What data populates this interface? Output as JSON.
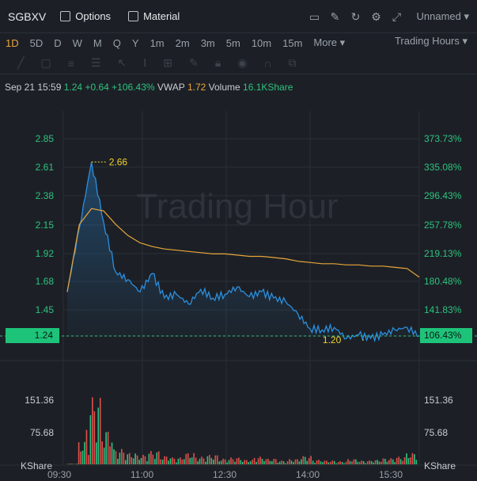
{
  "toolbar": {
    "ticker": "SGBXV",
    "options_label": "Options",
    "material_label": "Material",
    "layout_name": "Unnamed",
    "icons": [
      "chart-icon",
      "pen-icon",
      "refresh-icon",
      "gear-icon",
      "fullscreen-icon"
    ]
  },
  "periods": {
    "items": [
      "1D",
      "5D",
      "D",
      "W",
      "M",
      "Q",
      "Y",
      "1m",
      "2m",
      "3m",
      "5m",
      "10m",
      "15m",
      "More"
    ],
    "active": "1D",
    "session_label": "Trading Hours"
  },
  "info": {
    "datetime": "Sep 21 15:59",
    "last": "1.24",
    "change": "+0.64",
    "change_pct": "+106.43%",
    "vwap_label": "VWAP",
    "vwap": "1.72",
    "volume_label": "Volume",
    "volume": "16.1KShare"
  },
  "watermark": "Trading Hour",
  "price_axis": [
    "2.85",
    "2.61",
    "2.38",
    "2.15",
    "1.92",
    "1.68",
    "1.45"
  ],
  "pct_axis": [
    "373.73%",
    "335.08%",
    "296.43%",
    "257.78%",
    "219.13%",
    "180.48%",
    "141.83%"
  ],
  "current_price": "1.24",
  "current_pct": "106.43%",
  "high_label": "2.66",
  "low_label": "1.20",
  "volume_axis": [
    "151.36",
    "75.68"
  ],
  "volume_unit": "KShare",
  "time_axis": [
    "09:30",
    "11:00",
    "12:30",
    "14:00",
    "15:30"
  ],
  "colors": {
    "price_line": "#2b8fe0",
    "vwap_line": "#e9a53a",
    "up": "#2ec27e",
    "down": "#e0504a",
    "badge": "#1ec37a"
  },
  "chart_data": {
    "type": "line",
    "x": [
      "09:30",
      "09:35",
      "09:40",
      "09:45",
      "09:50",
      "10:00",
      "10:15",
      "10:30",
      "10:45",
      "11:00",
      "11:15",
      "11:30",
      "11:45",
      "12:00",
      "12:15",
      "12:30",
      "12:45",
      "13:00",
      "13:15",
      "13:30",
      "13:45",
      "14:00",
      "14:15",
      "14:30",
      "14:45",
      "15:00",
      "15:15",
      "15:30",
      "15:45",
      "15:59"
    ],
    "series": [
      {
        "values": [
          1.6,
          2.12,
          2.66,
          2.17,
          1.76,
          1.7,
          1.6,
          1.75,
          1.55,
          1.58,
          1.5,
          1.62,
          1.55,
          1.58,
          1.64,
          1.56,
          1.6,
          1.55,
          1.52,
          1.42,
          1.3,
          1.29,
          1.31,
          1.22,
          1.25,
          1.22,
          1.25,
          1.29,
          1.31,
          1.24
        ]
      },
      {
        "values": [
          1.6,
          2.15,
          2.28,
          2.26,
          2.15,
          2.06,
          2.0,
          1.97,
          1.95,
          1.94,
          1.93,
          1.92,
          1.91,
          1.91,
          1.9,
          1.89,
          1.89,
          1.88,
          1.87,
          1.85,
          1.84,
          1.83,
          1.83,
          1.82,
          1.82,
          1.81,
          1.81,
          1.8,
          1.79,
          1.72
        ]
      }
    ],
    "ylim": [
      1.24,
      2.85
    ],
    "volume": [
      2,
      60,
      175,
      90,
      40,
      30,
      25,
      35,
      22,
      18,
      30,
      20,
      25,
      15,
      18,
      12,
      20,
      15,
      10,
      14,
      22,
      12,
      10,
      8,
      14,
      10,
      12,
      16,
      20,
      30
    ],
    "volume_ylim": [
      0,
      151.36
    ]
  }
}
